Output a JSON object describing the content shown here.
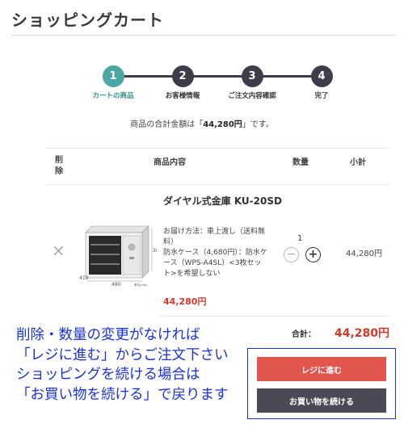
{
  "page": {
    "title": "ショッピングカート"
  },
  "steps": [
    {
      "number": "1",
      "label": "カートの商品",
      "active": true
    },
    {
      "number": "2",
      "label": "お客様情報",
      "active": false
    },
    {
      "number": "3",
      "label": "ご注文内容確認",
      "active": false
    },
    {
      "number": "4",
      "label": "完了",
      "active": false
    }
  ],
  "summary": {
    "prefix": "商品の合計金額は「",
    "amount": "44,280円",
    "suffix": "」です。"
  },
  "table": {
    "headers": {
      "delete": "削除",
      "item": "商品内容",
      "quantity": "数量",
      "subtotal": "小計"
    }
  },
  "item": {
    "remove_icon": "×",
    "name": "ダイヤル式金庫 KU-20SD",
    "details": "お届け方法：車上渡し（送料無料）\n防水ケース（4,680円）：防水ケース（WPS-A4SL）<3枚セット>を希望しない",
    "price": "44,280円",
    "quantity": "1",
    "minus_label": "−",
    "plus_label": "+",
    "subtotal": "44,280円",
    "image_dims": {
      "height": "388",
      "width": "480",
      "depth": "419",
      "unit": "単位(mm)"
    }
  },
  "totals": {
    "label": "合計：",
    "value": "44,280円"
  },
  "buttons": {
    "checkout": "レジに進む",
    "continue": "お買い物を続ける"
  },
  "annotation": {
    "lines": [
      "削除・数量の変更がなければ",
      "「レジに進む」からご注文下さい",
      "ショッピングを続ける場合は",
      "「お買い物を続ける」で戻ります"
    ]
  },
  "colors": {
    "accent": "#4aa7a3",
    "dark": "#3d3d49",
    "price": "#d43a2c",
    "checkout": "#e2564d",
    "annotation": "#1a32d8"
  }
}
